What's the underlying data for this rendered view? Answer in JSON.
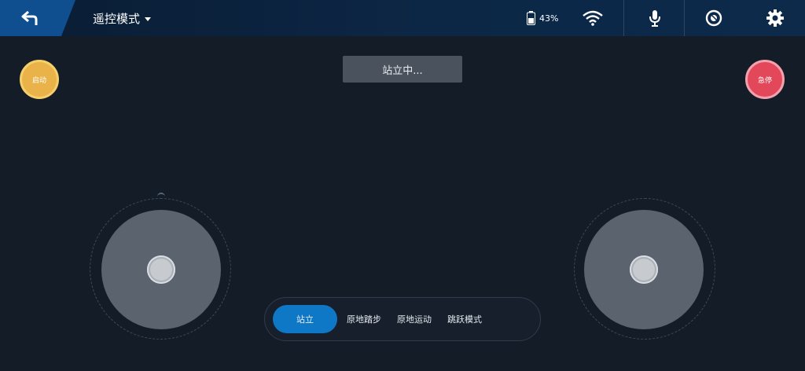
{
  "header": {
    "back_icon": "back-arrow-icon",
    "mode_label": "遥控模式",
    "battery_percent": "43%",
    "icons": [
      "battery-icon",
      "wifi-icon",
      "microphone-icon",
      "camera-lens-icon",
      "gear-icon"
    ]
  },
  "toast": {
    "text": "站立中..."
  },
  "buttons": {
    "left_round": "启动",
    "right_round": "急停"
  },
  "joysticks": {
    "left_knob_position": [
      0,
      0
    ],
    "right_knob_position": [
      0,
      0
    ]
  },
  "modes": {
    "items": [
      "站立",
      "原地踏步",
      "原地运动",
      "跳跃模式"
    ],
    "active_index": 0
  },
  "colors": {
    "accent": "#0f78c6",
    "left_button": "#e9b34a",
    "right_button": "#e3475a",
    "background": "#141c27"
  }
}
